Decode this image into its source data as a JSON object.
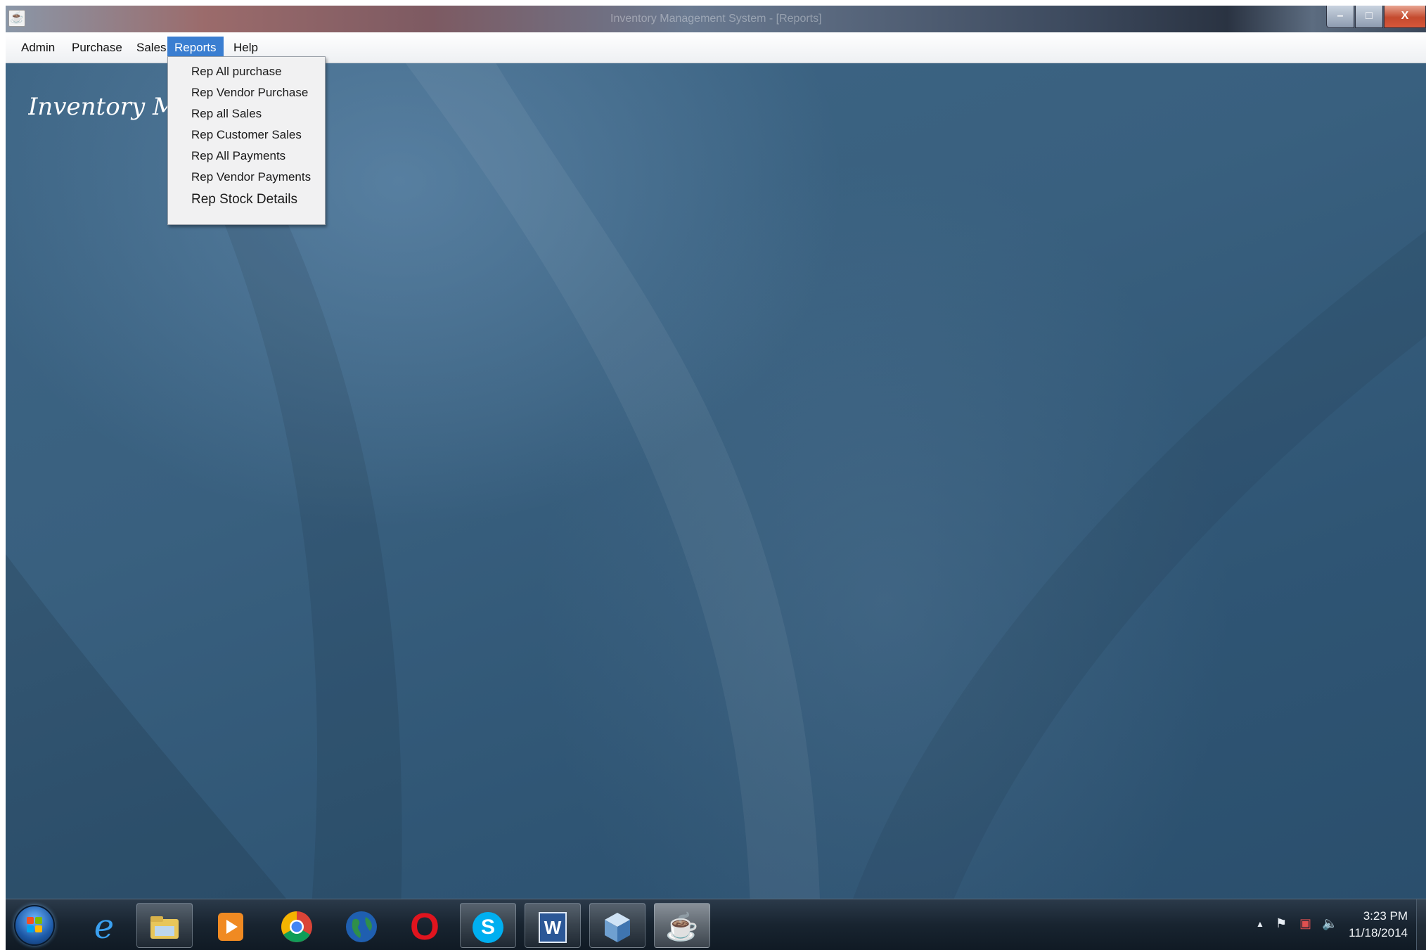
{
  "window": {
    "title": "Inventory Management System - [Reports]",
    "controls": {
      "minimize": "–",
      "maximize": "□",
      "close": "X"
    }
  },
  "menubar": {
    "items": [
      {
        "label": "Admin"
      },
      {
        "label": "Purchase"
      },
      {
        "label": "Sales"
      },
      {
        "label": "Reports"
      },
      {
        "label": "Help"
      }
    ],
    "active": "Reports"
  },
  "reports_menu": {
    "items": [
      "Rep All purchase",
      "Rep Vendor Purchase",
      "Rep all Sales",
      "Rep Customer Sales",
      "Rep All Payments",
      "Rep Vendor Payments",
      "Rep Stock Details"
    ]
  },
  "main": {
    "title": "Inventory Management System"
  },
  "taskbar": {
    "pinned": [
      {
        "icon": "internet-explorer-icon",
        "glyph": "e"
      },
      {
        "icon": "file-explorer-icon",
        "glyph": ""
      },
      {
        "icon": "media-player-icon",
        "glyph": "▶"
      },
      {
        "icon": "chrome-icon",
        "glyph": ""
      },
      {
        "icon": "globe-icon",
        "glyph": ""
      },
      {
        "icon": "opera-icon",
        "glyph": "O"
      },
      {
        "icon": "skype-icon",
        "glyph": "S"
      },
      {
        "icon": "word-icon",
        "glyph": "W"
      },
      {
        "icon": "virtualbox-icon",
        "glyph": ""
      },
      {
        "icon": "java-icon",
        "glyph": "☕"
      }
    ],
    "clock": {
      "time": "3:23 PM",
      "date": "11/18/2014"
    }
  },
  "colors": {
    "desktop": "#3a6080",
    "menu_active": "#3a7ed1",
    "dropdown_bg": "#f1f1f2",
    "taskbar": "#182430"
  }
}
